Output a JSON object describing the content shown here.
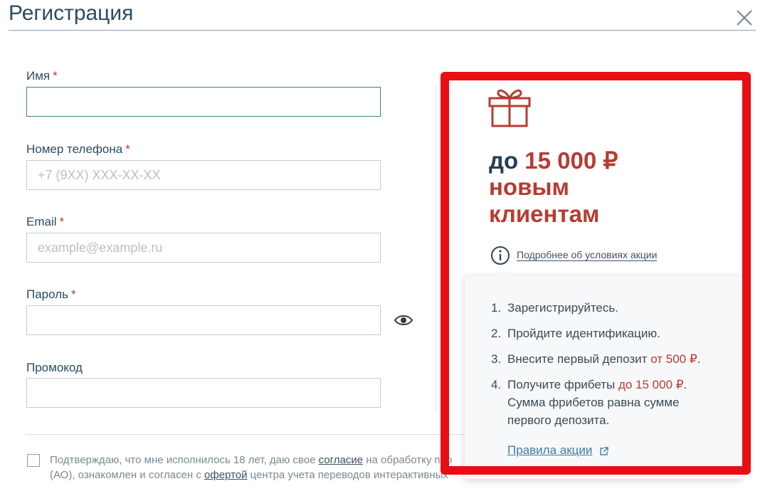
{
  "dialog": {
    "title": "Регистрация",
    "close_icon": "close-icon"
  },
  "form": {
    "required_mark": "*",
    "name": {
      "label": "Имя",
      "value": "",
      "placeholder": ""
    },
    "phone": {
      "label": "Номер телефона",
      "value": "",
      "placeholder": "+7 (9XX) XXX-XX-XX"
    },
    "email": {
      "label": "Email",
      "value": "",
      "placeholder": "example@example.ru"
    },
    "password": {
      "label": "Пароль",
      "value": "",
      "placeholder": "",
      "toggle_icon": "eye-icon"
    },
    "promo": {
      "label": "Промокод",
      "value": "",
      "placeholder": ""
    },
    "consent": {
      "text1": "Подтверждаю, что мне исполнилось 18 лет, даю свое ",
      "link1": "согласие",
      "text2": " на обработку пер",
      "text3": "(АО), ознакомлен и согласен с ",
      "link2": "офертой",
      "text4": " центра учета переводов интерактивных"
    }
  },
  "promo_panel": {
    "gift_icon": "gift-icon",
    "prefix": "до",
    "amount": "15 000 ₽",
    "line2": "новым",
    "line3": "клиентам",
    "info_icon": "info-icon",
    "conditions_link": "Подробнее об условиях акции",
    "accent_color": "#b83b32",
    "frame_color": "#e80e14"
  },
  "popover": {
    "steps": [
      {
        "num": "1.",
        "text": "Зарегистрируйтесь."
      },
      {
        "num": "2.",
        "text": "Пройдите идентификацию."
      },
      {
        "num": "3.",
        "text": "Внесите первый депозит ",
        "highlight": "от 500 ₽",
        "tail": "."
      },
      {
        "num": "4.",
        "text": "Получите фрибеты ",
        "highlight": "до 15 000 ₽",
        "tail": ".",
        "line2": "Сумма фрибетов равна сумме",
        "line3": "первого депозита."
      }
    ],
    "rules_link": "Правила акции",
    "external_icon": "external-link-icon"
  }
}
